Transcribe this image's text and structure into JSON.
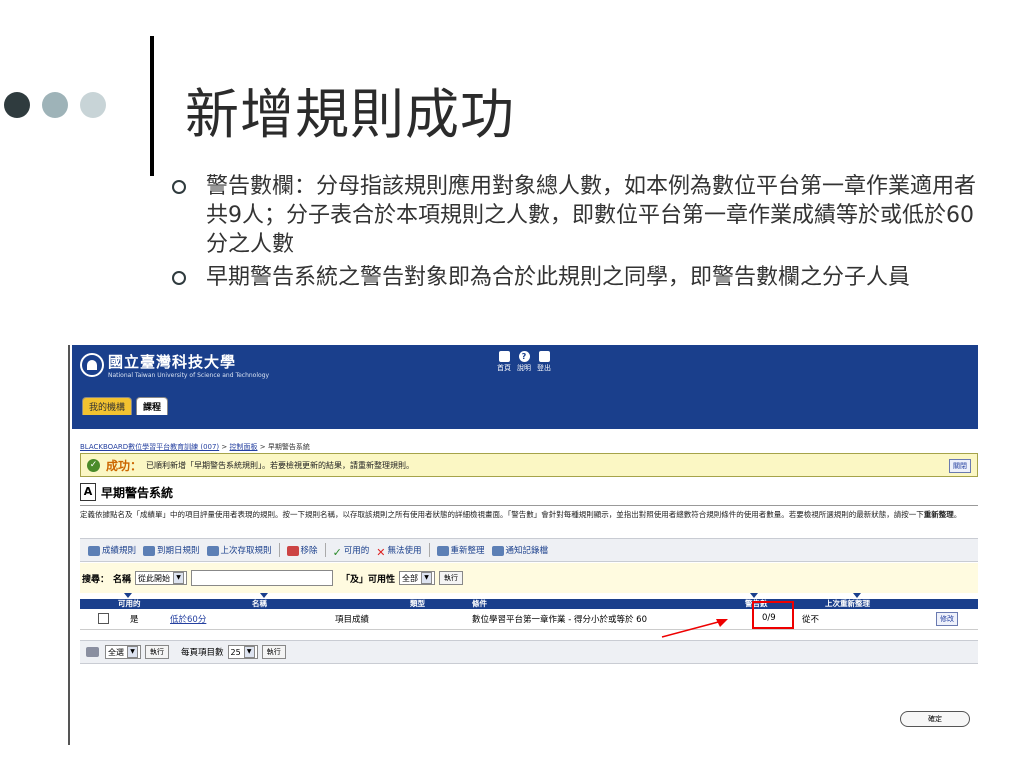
{
  "slide": {
    "title": "新增規則成功",
    "bullets": [
      "警告數欄：分母指該規則應用對象總人數，如本例為數位平台第一章作業適用者共9人；分子表合於本項規則之人數，即數位平台第一章作業成績等於或低於60分之人數",
      "早期警告系統之警告對象即為合於此規則之同學，即警告數欄之分子人員"
    ]
  },
  "app": {
    "logo_cn": "國立臺灣科技大學",
    "logo_en": "National Taiwan University of Science and Technology",
    "topnav": [
      "首頁",
      "說明",
      "登出"
    ],
    "tabs": [
      "我的機構",
      "課程"
    ],
    "breadcrumb": {
      "link1": "BLACKBOARD數位學習平台教育訓練 (007)",
      "sep": " > ",
      "link2": "控制面板",
      "current": "早期警告系統"
    },
    "success": {
      "label": "成功：",
      "message": "已順利新增「早期警告系統規則」。若要檢視更新的結果，請重新整理規則。",
      "close": "關閉"
    },
    "system_title": "早期警告系統",
    "description": "定義依據點名及「成績單」中的項目評量使用者表現的規則。按一下規則名稱，以存取該規則之所有使用者狀態的詳細檢視畫面。「警告數」會針對每種規則顯示，並指出對照使用者總數符合規則條件的使用者數量。若要檢視所選規則的最新狀態，請按一下",
    "description_bold": "重新整理",
    "description_end": "。",
    "toolbar": [
      "成績規則",
      "到期日規則",
      "上次存取規則",
      "移除",
      "可用的",
      "無法使用",
      "重新整理",
      "通知記錄檔"
    ],
    "search": {
      "label": "搜尋：",
      "field_label": "名稱",
      "field_op": "從此開始",
      "and_label": "「及」可用性",
      "avail": "全部",
      "go": "執行"
    },
    "table": {
      "headers": [
        "可用的",
        "名稱",
        "類型",
        "條件",
        "警告數",
        "上次重新整理"
      ],
      "row": {
        "available": "是",
        "name": "低於60分",
        "type": "項目成績",
        "condition": "數位學習平台第一章作業 - 得分小於或等於 60",
        "warnings": "0/9",
        "last_refresh": "從不",
        "edit": "修改"
      }
    },
    "bottom": {
      "select_all": "全選",
      "go": "執行",
      "per_page_label": "每頁項目數",
      "per_page": "25",
      "go2": "執行"
    },
    "confirm": "確定"
  },
  "colors": {
    "header": "#1a3f8c",
    "success_bg": "#fbf7c4",
    "highlight": "#e00000"
  }
}
